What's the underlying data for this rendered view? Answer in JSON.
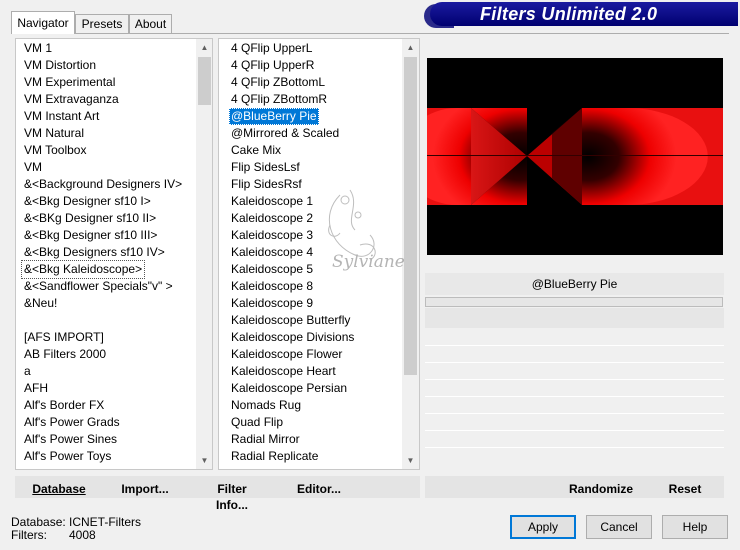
{
  "app": {
    "title": "Filters Unlimited 2.0"
  },
  "tabs": [
    {
      "label": "Navigator",
      "active": true
    },
    {
      "label": "Presets",
      "active": false
    },
    {
      "label": "About",
      "active": false
    }
  ],
  "categories": {
    "items": [
      "VM 1",
      "VM Distortion",
      "VM Experimental",
      "VM Extravaganza",
      "VM Instant Art",
      "VM Natural",
      "VM Toolbox",
      "VM",
      "&<Background Designers IV>",
      "&<Bkg Designer sf10 I>",
      "&<BKg Designer sf10 II>",
      "&<Bkg Designer sf10 III>",
      "&<Bkg Designers sf10 IV>",
      "&<Bkg Kaleidoscope>",
      "&<Sandflower Specials\"v\" >",
      "&Neu!",
      "",
      "[AFS IMPORT]",
      "AB Filters 2000",
      "a",
      "AFH",
      "Alf's Border FX",
      "Alf's Power Grads",
      "Alf's Power Sines",
      "Alf's Power Toys"
    ],
    "focused_index": 13
  },
  "filters": {
    "items": [
      "4 QFlip UpperL",
      "4 QFlip UpperR",
      "4 QFlip ZBottomL",
      "4 QFlip ZBottomR",
      "@BlueBerry Pie",
      "@Mirrored & Scaled",
      "Cake Mix",
      "Flip SidesLsf",
      "Flip SidesRsf",
      "Kaleidoscope 1",
      "Kaleidoscope 2",
      "Kaleidoscope 3",
      "Kaleidoscope 4",
      "Kaleidoscope 5",
      "Kaleidoscope 8",
      "Kaleidoscope 9",
      "Kaleidoscope Butterfly",
      "Kaleidoscope Divisions",
      "Kaleidoscope Flower",
      "Kaleidoscope Heart",
      "Kaleidoscope Persian",
      "Nomads Rug",
      "Quad Flip",
      "Radial Mirror",
      "Radial Replicate"
    ],
    "selected_index": 4
  },
  "preview": {
    "selected_filter": "@BlueBerry Pie",
    "watermark_text": "Sylviane"
  },
  "toolbar": {
    "database": "Database",
    "import": "Import...",
    "filter_info": "Filter Info...",
    "editor": "Editor...",
    "randomize": "Randomize",
    "reset": "Reset"
  },
  "status": {
    "database_label": "Database:",
    "database_value": "ICNET-Filters",
    "filters_label": "Filters:",
    "filters_value": "4008"
  },
  "buttons": {
    "apply": "Apply",
    "cancel": "Cancel",
    "help": "Help"
  },
  "colors": {
    "banner": "#000080",
    "selection": "#0078d7",
    "accent_red": "#ff0000"
  }
}
